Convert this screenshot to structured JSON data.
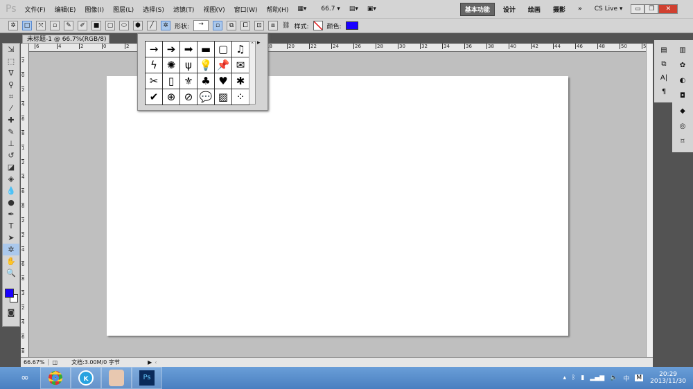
{
  "app": {
    "logo": "Ps",
    "menu": [
      "文件(F)",
      "编辑(E)",
      "图像(I)",
      "图层(L)",
      "选择(S)",
      "滤镜(T)",
      "视图(V)",
      "窗口(W)",
      "帮助(H)"
    ],
    "zoom_value": "66.7",
    "workspaces": [
      "基本功能",
      "设计",
      "绘画",
      "摄影"
    ],
    "more": "»",
    "cs_live": "CS Live ▾"
  },
  "options": {
    "shape_label": "形状:",
    "style_label": "样式:",
    "color_label": "颜色:",
    "fill_color": "#1a00ff",
    "shape_value": "→"
  },
  "document": {
    "tab_title": "未标题-1 @ 66.7%(RGB/8)",
    "close": "×",
    "hruler_labels": [
      "8",
      "6",
      "4",
      "2",
      "0",
      "2",
      "18",
      "20",
      "22",
      "24",
      "26",
      "28",
      "30",
      "32",
      "34",
      "36",
      "38",
      "40",
      "42",
      "44",
      "46",
      "48",
      "50",
      "52",
      "54"
    ],
    "vruler_labels": [
      "2",
      "0",
      "2",
      "4",
      "6",
      "8",
      "1",
      "2",
      "4",
      "6",
      "8",
      "2",
      "2",
      "4",
      "6",
      "8",
      "3",
      "2",
      "4",
      "6",
      "8"
    ]
  },
  "status": {
    "zoom": "66.67%",
    "doc_info": "文档:3.00M/0 字节"
  },
  "shape_picker": {
    "shapes": [
      "→",
      "➔",
      "➡",
      "▬",
      "▢",
      "♫",
      "ϟ",
      "✺",
      "ψ",
      "💡",
      "📌",
      "✉",
      "✂",
      "▯",
      "⚜",
      "♣",
      "♥",
      "✱",
      "✔",
      "⊕",
      "⊘",
      "💬",
      "▨",
      "⁘"
    ]
  },
  "toolbox": {
    "foreground_color": "#1a00ff",
    "background_color": "#ffffff"
  },
  "taskbar": {
    "time": "20:29",
    "date": "2013/11/30",
    "ime": "M",
    "lang": "中"
  }
}
